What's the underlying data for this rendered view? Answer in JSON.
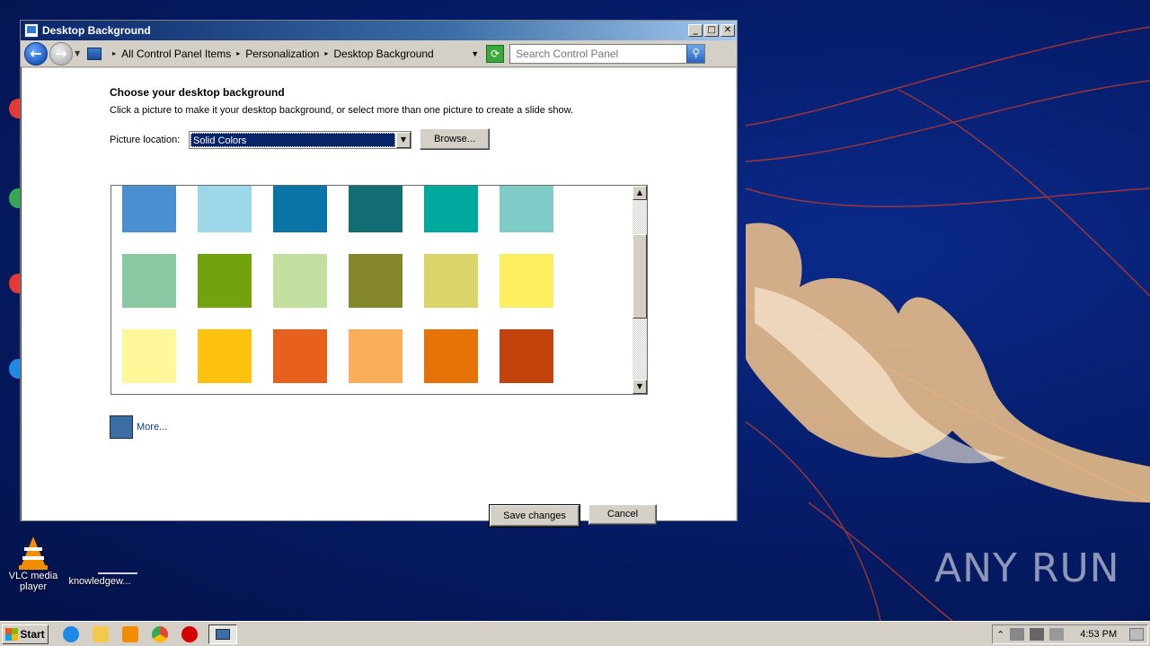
{
  "window": {
    "title": "Desktop Background",
    "breadcrumbs": [
      "All Control Panel Items",
      "Personalization",
      "Desktop Background"
    ],
    "search_placeholder": "Search Control Panel"
  },
  "content": {
    "heading": "Choose your desktop background",
    "subtext": "Click a picture to make it your desktop background, or select more than one picture to create a slide show.",
    "location_label": "Picture location:",
    "location_value": "Solid Colors",
    "browse_label": "Browse...",
    "swatches": [
      "#4a90d0",
      "#9dd8ea",
      "#0a74a6",
      "#126e72",
      "#00a99d",
      "#7ecbc8",
      "#88c9a1",
      "#72a30e",
      "#c2dfa0",
      "#84882a",
      "#dbd46a",
      "#fdee60",
      "#fef89b",
      "#fec20e",
      "#e8601e",
      "#f9ae5c",
      "#e57307",
      "#c3430c"
    ],
    "more_color": "#3a6ea5",
    "more_label": "More...",
    "save_label": "Save changes",
    "cancel_label": "Cancel"
  },
  "desktop": {
    "icons": [
      {
        "label": "VLC media player"
      },
      {
        "label": "knowledgew..."
      }
    ],
    "watermark": "ANY RUN"
  },
  "taskbar": {
    "start_label": "Start",
    "clock": "4:53 PM"
  }
}
